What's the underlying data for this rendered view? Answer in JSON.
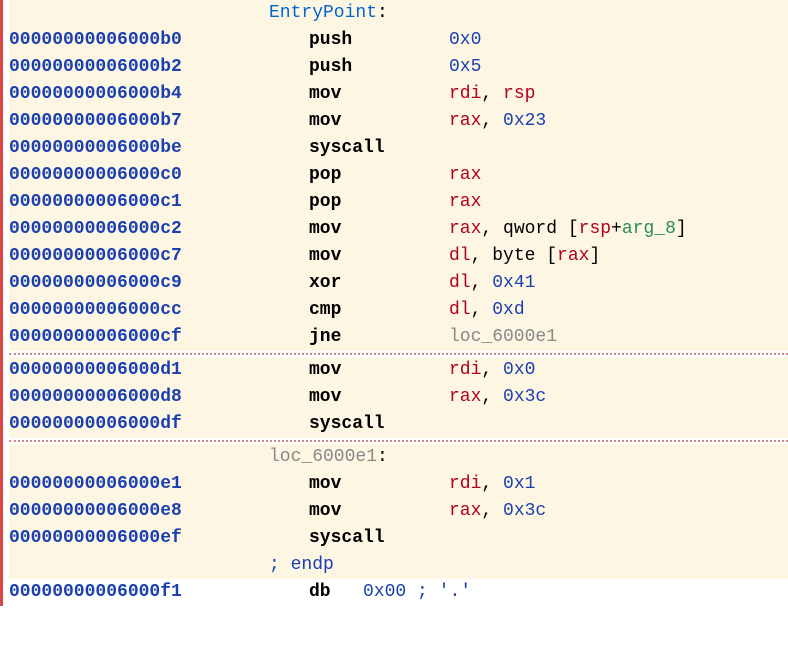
{
  "labels": {
    "entry": "EntryPoint",
    "loc": "loc_6000e1",
    "endp": "; endp"
  },
  "colons": {
    "c": ":"
  },
  "punct": {
    "comma": ", ",
    "lbr": " [",
    "rbr": "]",
    "plus": "+"
  },
  "kw": {
    "qword": "qword",
    "byte": "byte",
    "db": "db"
  },
  "block1": [
    {
      "addr": "00000000006000b0",
      "m": "push",
      "ops": [
        {
          "t": "num",
          "v": "0x0"
        }
      ]
    },
    {
      "addr": "00000000006000b2",
      "m": "push",
      "ops": [
        {
          "t": "num",
          "v": "0x5"
        }
      ]
    },
    {
      "addr": "00000000006000b4",
      "m": "mov",
      "ops": [
        {
          "t": "reg",
          "v": "rdi"
        },
        {
          "t": "comma"
        },
        {
          "t": "reg",
          "v": "rsp"
        }
      ]
    },
    {
      "addr": "00000000006000b7",
      "m": "mov",
      "ops": [
        {
          "t": "reg",
          "v": "rax"
        },
        {
          "t": "comma"
        },
        {
          "t": "num",
          "v": "0x23"
        }
      ]
    },
    {
      "addr": "00000000006000be",
      "m": "syscall",
      "ops": []
    },
    {
      "addr": "00000000006000c0",
      "m": "pop",
      "ops": [
        {
          "t": "reg",
          "v": "rax"
        }
      ]
    },
    {
      "addr": "00000000006000c1",
      "m": "pop",
      "ops": [
        {
          "t": "reg",
          "v": "rax"
        }
      ]
    },
    {
      "addr": "00000000006000c2",
      "m": "mov",
      "ops": [
        {
          "t": "reg",
          "v": "rax"
        },
        {
          "t": "comma"
        },
        {
          "t": "kw",
          "v": "qword"
        },
        {
          "t": "lbr"
        },
        {
          "t": "reg",
          "v": "rsp"
        },
        {
          "t": "plus"
        },
        {
          "t": "sv",
          "v": "arg_8"
        },
        {
          "t": "rbr"
        }
      ]
    },
    {
      "addr": "00000000006000c7",
      "m": "mov",
      "ops": [
        {
          "t": "reg",
          "v": "dl"
        },
        {
          "t": "comma"
        },
        {
          "t": "kw",
          "v": "byte"
        },
        {
          "t": "lbr"
        },
        {
          "t": "reg",
          "v": "rax"
        },
        {
          "t": "rbr"
        }
      ]
    },
    {
      "addr": "00000000006000c9",
      "m": "xor",
      "ops": [
        {
          "t": "reg",
          "v": "dl"
        },
        {
          "t": "comma"
        },
        {
          "t": "num",
          "v": "0x41"
        }
      ]
    },
    {
      "addr": "00000000006000cc",
      "m": "cmp",
      "ops": [
        {
          "t": "reg",
          "v": "dl"
        },
        {
          "t": "comma"
        },
        {
          "t": "num",
          "v": "0xd"
        }
      ]
    },
    {
      "addr": "00000000006000cf",
      "m": "jne",
      "ops": [
        {
          "t": "lblg",
          "v": "loc_6000e1"
        }
      ]
    }
  ],
  "block2": [
    {
      "addr": "00000000006000d1",
      "m": "mov",
      "ops": [
        {
          "t": "reg",
          "v": "rdi"
        },
        {
          "t": "comma"
        },
        {
          "t": "num",
          "v": "0x0"
        }
      ]
    },
    {
      "addr": "00000000006000d8",
      "m": "mov",
      "ops": [
        {
          "t": "reg",
          "v": "rax"
        },
        {
          "t": "comma"
        },
        {
          "t": "num",
          "v": "0x3c"
        }
      ]
    },
    {
      "addr": "00000000006000df",
      "m": "syscall",
      "ops": []
    }
  ],
  "block3": [
    {
      "addr": "00000000006000e1",
      "m": "mov",
      "ops": [
        {
          "t": "reg",
          "v": "rdi"
        },
        {
          "t": "comma"
        },
        {
          "t": "num",
          "v": "0x1"
        }
      ]
    },
    {
      "addr": "00000000006000e8",
      "m": "mov",
      "ops": [
        {
          "t": "reg",
          "v": "rax"
        },
        {
          "t": "comma"
        },
        {
          "t": "num",
          "v": "0x3c"
        }
      ]
    },
    {
      "addr": "00000000006000ef",
      "m": "syscall",
      "ops": []
    }
  ],
  "datarow": {
    "addr": "00000000006000f1",
    "db": "db",
    "val": "0x00",
    "comment": " ; '.'"
  }
}
